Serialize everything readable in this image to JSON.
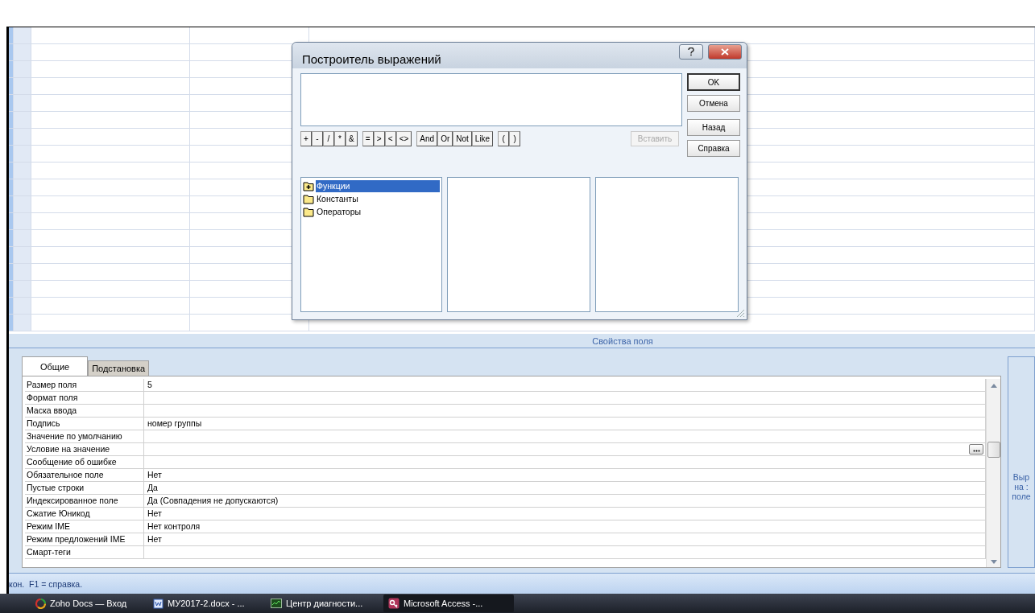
{
  "dialog": {
    "title": "Построитель выражений",
    "buttons": [
      {
        "label": "OK",
        "default": true
      },
      {
        "label": "Отмена",
        "default": false
      },
      {
        "label": "Назад",
        "default": false
      },
      {
        "label": "Справка",
        "default": false
      }
    ],
    "operators": [
      [
        "+",
        "-",
        "/",
        "*",
        "&"
      ],
      [
        "=",
        ">",
        "<",
        "<>"
      ],
      [
        "And",
        "Or",
        "Not",
        "Like"
      ],
      [
        "(",
        ")"
      ]
    ],
    "insert_button": {
      "label": "Вставить",
      "disabled": true
    },
    "tree": [
      {
        "label": "Функции",
        "selected": true,
        "expandable": true
      },
      {
        "label": "Константы",
        "selected": false,
        "expandable": false
      },
      {
        "label": "Операторы",
        "selected": false,
        "expandable": false
      }
    ]
  },
  "properties": {
    "header": "Свойства поля",
    "tabs": [
      {
        "label": "Общие",
        "selected": true
      },
      {
        "label": "Подстановка",
        "selected": false
      }
    ],
    "rows": [
      {
        "label": "Размер поля",
        "value": "5"
      },
      {
        "label": "Формат поля"
      },
      {
        "label": "Маска ввода"
      },
      {
        "label": "Подпись",
        "value": "номер группы"
      },
      {
        "label": "Значение по умолчанию"
      },
      {
        "label": "Условие на значение",
        "builder": true
      },
      {
        "label": "Сообщение об ошибке"
      },
      {
        "label": "Обязательное поле",
        "value": "Нет"
      },
      {
        "label": "Пустые строки",
        "value": "Да"
      },
      {
        "label": "Индексированное поле",
        "value": "Да (Совпадения не допускаются)"
      },
      {
        "label": "Сжатие Юникод",
        "value": "Нет"
      },
      {
        "label": "Режим IME",
        "value": "Нет контроля"
      },
      {
        "label": "Режим предложений IME",
        "value": "Нет"
      },
      {
        "label": "Смарт-теги"
      }
    ],
    "help_lines": [
      "Выр",
      "на :",
      "поле"
    ]
  },
  "status_bar": "кон.  F1 = справка.",
  "taskbar": [
    {
      "label": "Zoho Docs — Вход",
      "kind": "browser",
      "active": false
    },
    {
      "label": "МУ2017-2.docx - ...",
      "kind": "word",
      "active": false
    },
    {
      "label": "Центр диагности...",
      "kind": "monitor",
      "active": false
    },
    {
      "label": "Microsoft Access -...",
      "kind": "access",
      "active": true
    }
  ]
}
